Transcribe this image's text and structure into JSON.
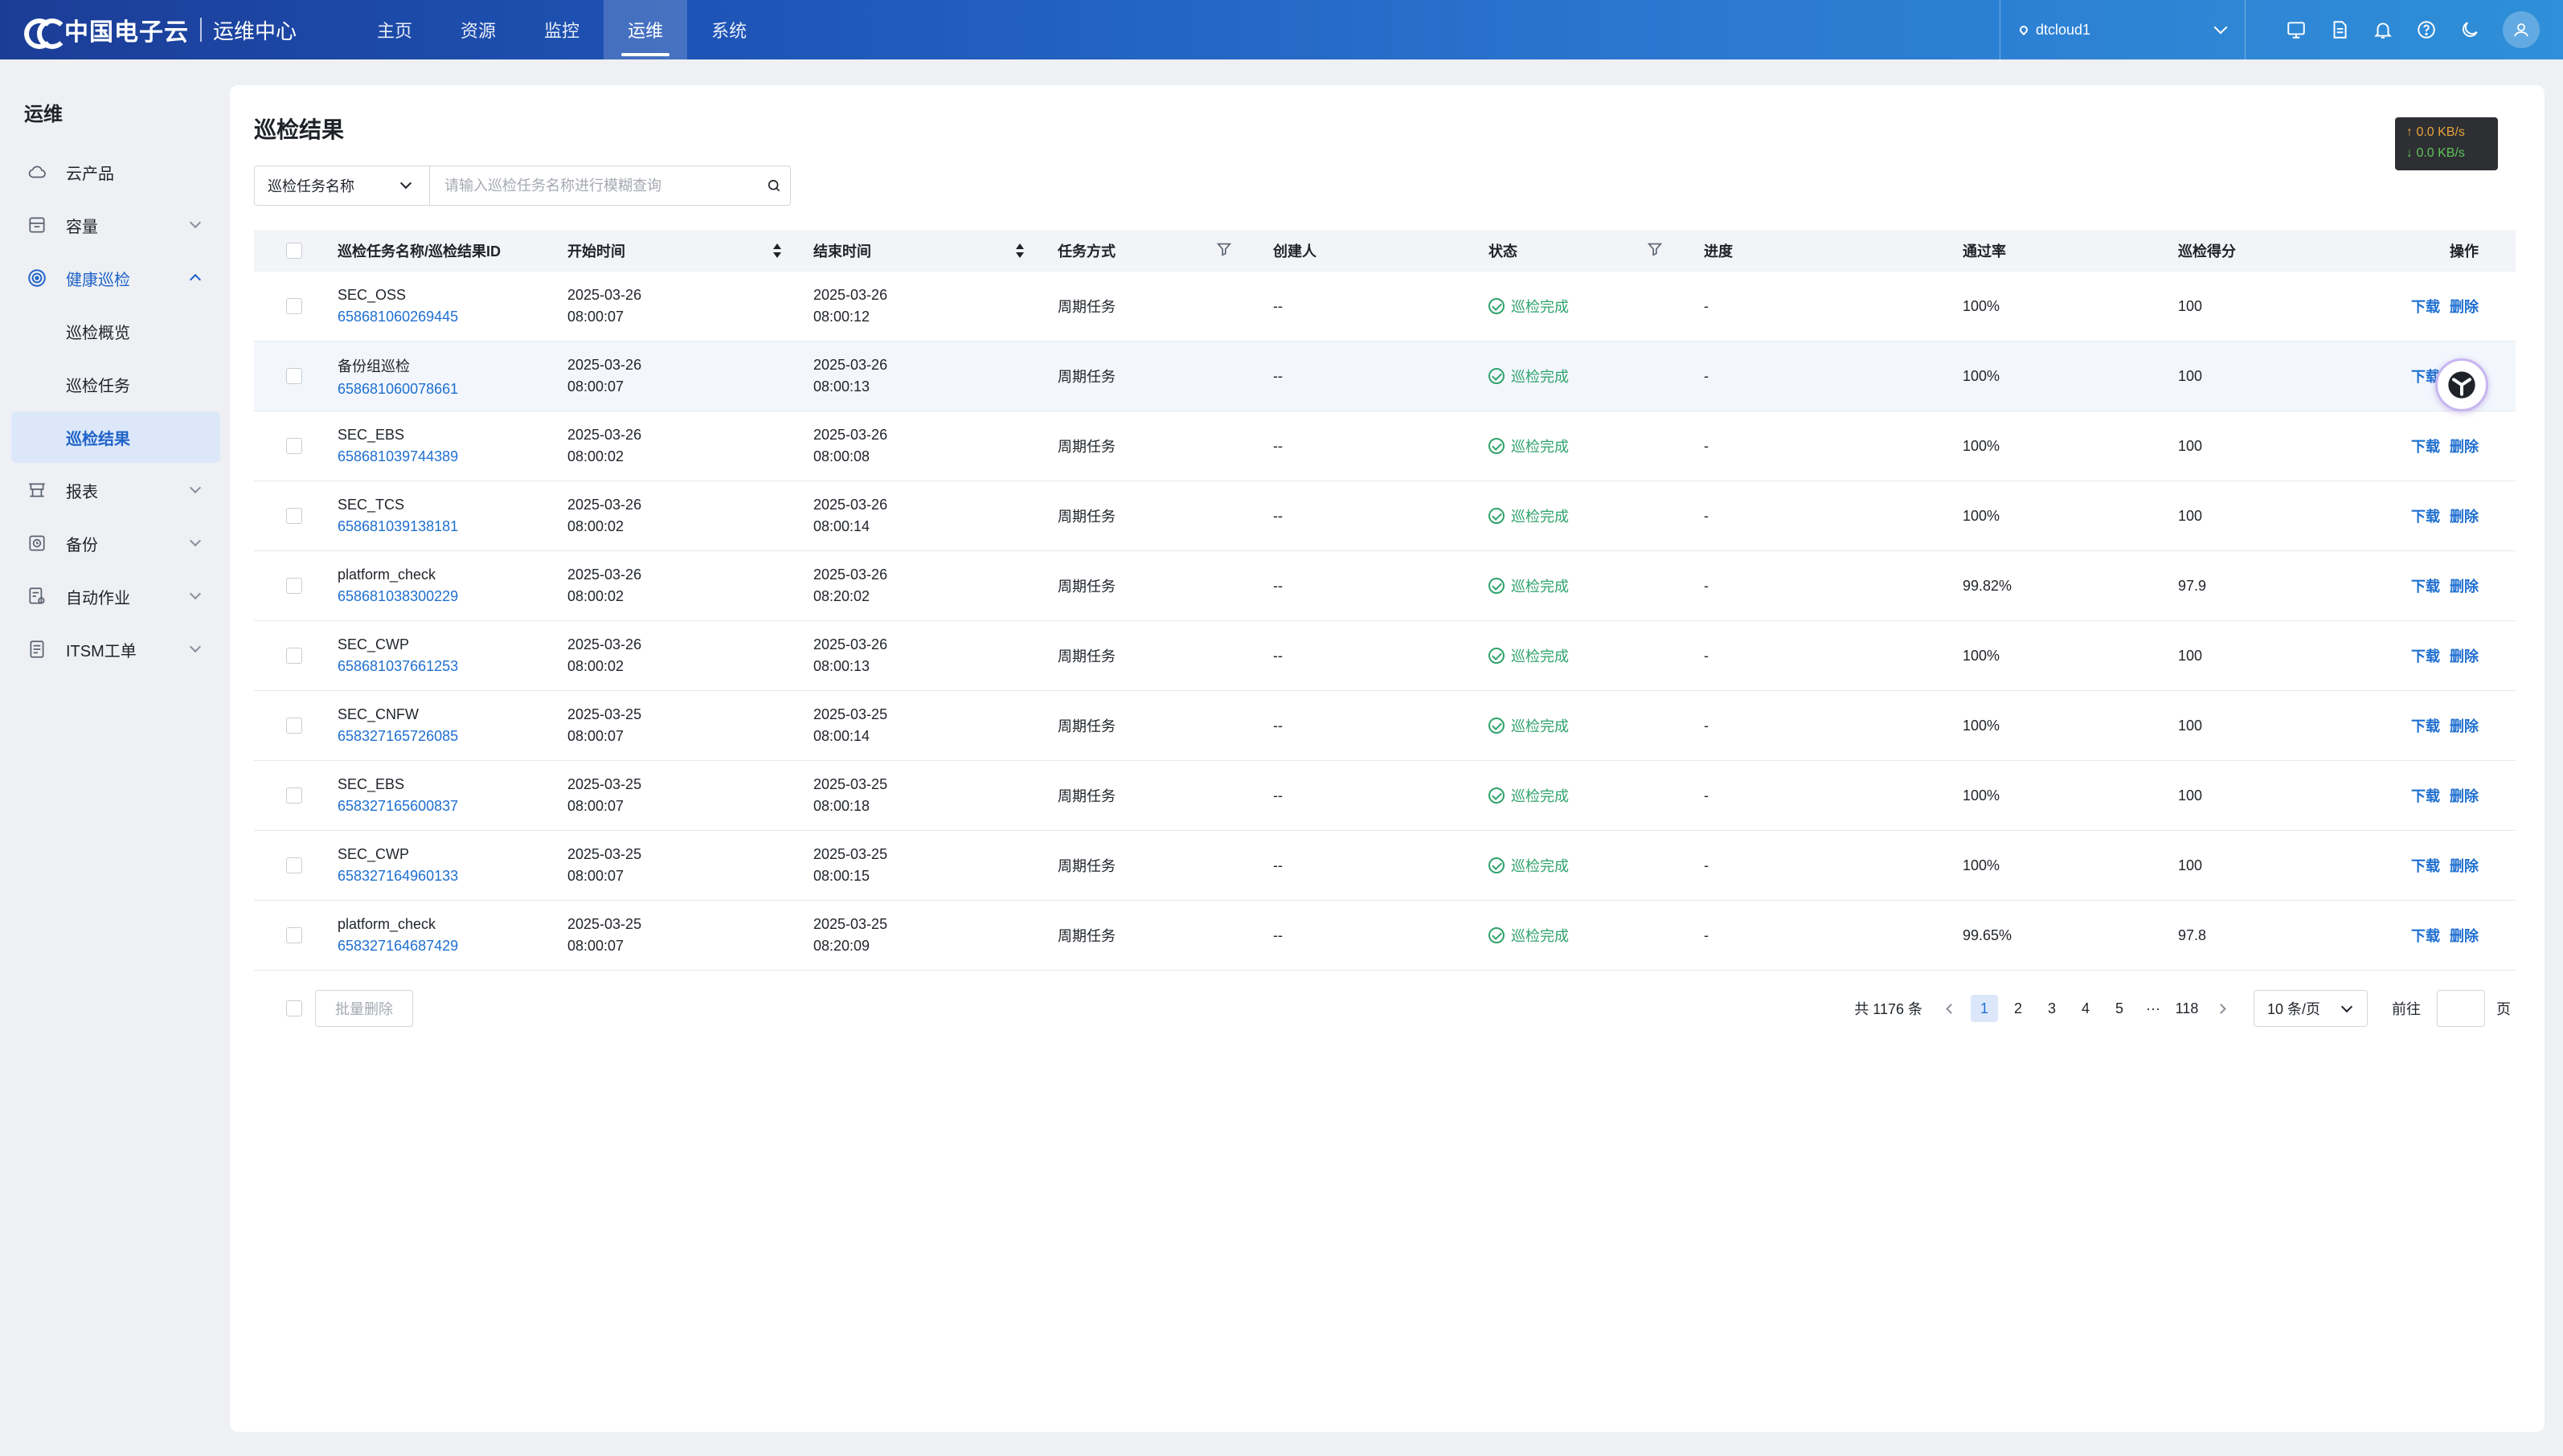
{
  "app": {
    "logo": "中国电子云",
    "title": "运维中心",
    "nav": [
      "主页",
      "资源",
      "监控",
      "运维",
      "系统"
    ],
    "nav_active": "运维",
    "region": "dtcloud1"
  },
  "sidebar": {
    "title": "运维",
    "items": [
      {
        "label": "云产品",
        "icon": "cloud-icon"
      },
      {
        "label": "容量",
        "icon": "box-icon"
      },
      {
        "label": "健康巡检",
        "icon": "target-icon"
      },
      {
        "label": "巡检概览"
      },
      {
        "label": "巡检任务"
      },
      {
        "label": "巡检结果"
      },
      {
        "label": "报表",
        "icon": "report-icon"
      },
      {
        "label": "备份",
        "icon": "backup-icon"
      },
      {
        "label": "自动作业",
        "icon": "automation-icon"
      },
      {
        "label": "ITSM工单",
        "icon": "ticket-icon"
      }
    ]
  },
  "page": {
    "title": "巡检结果",
    "net_up": "↑ 0.0 KB/s",
    "net_down": "↓ 0.0 KB/s",
    "search": {
      "field": "巡检任务名称",
      "placeholder": "请输入巡检任务名称进行模糊查询"
    }
  },
  "table": {
    "headers": [
      "巡检任务名称/巡检结果ID",
      "开始时间",
      "结束时间",
      "任务方式",
      "创建人",
      "状态",
      "进度",
      "通过率",
      "巡检得分",
      "操作"
    ],
    "rows": [
      {
        "name": "SEC_OSS",
        "id": "658681060269445",
        "start_date": "2025-03-26",
        "start_time": "08:00:07",
        "end_date": "2025-03-26",
        "end_time": "08:00:12",
        "mode": "周期任务",
        "creator": "--",
        "status": "巡检完成",
        "progress": "-",
        "pass": "100%",
        "score": "100"
      },
      {
        "name": "备份组巡检",
        "id": "658681060078661",
        "start_date": "2025-03-26",
        "start_time": "08:00:07",
        "end_date": "2025-03-26",
        "end_time": "08:00:13",
        "mode": "周期任务",
        "creator": "--",
        "status": "巡检完成",
        "progress": "-",
        "pass": "100%",
        "score": "100"
      },
      {
        "name": "SEC_EBS",
        "id": "658681039744389",
        "start_date": "2025-03-26",
        "start_time": "08:00:02",
        "end_date": "2025-03-26",
        "end_time": "08:00:08",
        "mode": "周期任务",
        "creator": "--",
        "status": "巡检完成",
        "progress": "-",
        "pass": "100%",
        "score": "100"
      },
      {
        "name": "SEC_TCS",
        "id": "658681039138181",
        "start_date": "2025-03-26",
        "start_time": "08:00:02",
        "end_date": "2025-03-26",
        "end_time": "08:00:14",
        "mode": "周期任务",
        "creator": "--",
        "status": "巡检完成",
        "progress": "-",
        "pass": "100%",
        "score": "100"
      },
      {
        "name": "platform_check",
        "id": "658681038300229",
        "start_date": "2025-03-26",
        "start_time": "08:00:02",
        "end_date": "2025-03-26",
        "end_time": "08:20:02",
        "mode": "周期任务",
        "creator": "--",
        "status": "巡检完成",
        "progress": "-",
        "pass": "99.82%",
        "score": "97.9"
      },
      {
        "name": "SEC_CWP",
        "id": "658681037661253",
        "start_date": "2025-03-26",
        "start_time": "08:00:02",
        "end_date": "2025-03-26",
        "end_time": "08:00:13",
        "mode": "周期任务",
        "creator": "--",
        "status": "巡检完成",
        "progress": "-",
        "pass": "100%",
        "score": "100"
      },
      {
        "name": "SEC_CNFW",
        "id": "658327165726085",
        "start_date": "2025-03-25",
        "start_time": "08:00:07",
        "end_date": "2025-03-25",
        "end_time": "08:00:14",
        "mode": "周期任务",
        "creator": "--",
        "status": "巡检完成",
        "progress": "-",
        "pass": "100%",
        "score": "100"
      },
      {
        "name": "SEC_EBS",
        "id": "658327165600837",
        "start_date": "2025-03-25",
        "start_time": "08:00:07",
        "end_date": "2025-03-25",
        "end_time": "08:00:18",
        "mode": "周期任务",
        "creator": "--",
        "status": "巡检完成",
        "progress": "-",
        "pass": "100%",
        "score": "100"
      },
      {
        "name": "SEC_CWP",
        "id": "658327164960133",
        "start_date": "2025-03-25",
        "start_time": "08:00:07",
        "end_date": "2025-03-25",
        "end_time": "08:00:15",
        "mode": "周期任务",
        "creator": "--",
        "status": "巡检完成",
        "progress": "-",
        "pass": "100%",
        "score": "100"
      },
      {
        "name": "platform_check",
        "id": "658327164687429",
        "start_date": "2025-03-25",
        "start_time": "08:00:07",
        "end_date": "2025-03-25",
        "end_time": "08:20:09",
        "mode": "周期任务",
        "creator": "--",
        "status": "巡检完成",
        "progress": "-",
        "pass": "99.65%",
        "score": "97.8"
      }
    ],
    "ops": [
      "下载",
      "删除"
    ]
  },
  "footer": {
    "batch_delete": "批量删除",
    "total": "共 1176 条",
    "pages": [
      "1",
      "2",
      "3",
      "4",
      "5"
    ],
    "ellipsis": "···",
    "last_page": "118",
    "current_page": "1",
    "page_size": "10 条/页",
    "goto": "前往",
    "page_unit": "页"
  },
  "colors": {
    "brand": "#1f63c8",
    "link": "#1f6fd0",
    "success": "#2fa36b"
  }
}
